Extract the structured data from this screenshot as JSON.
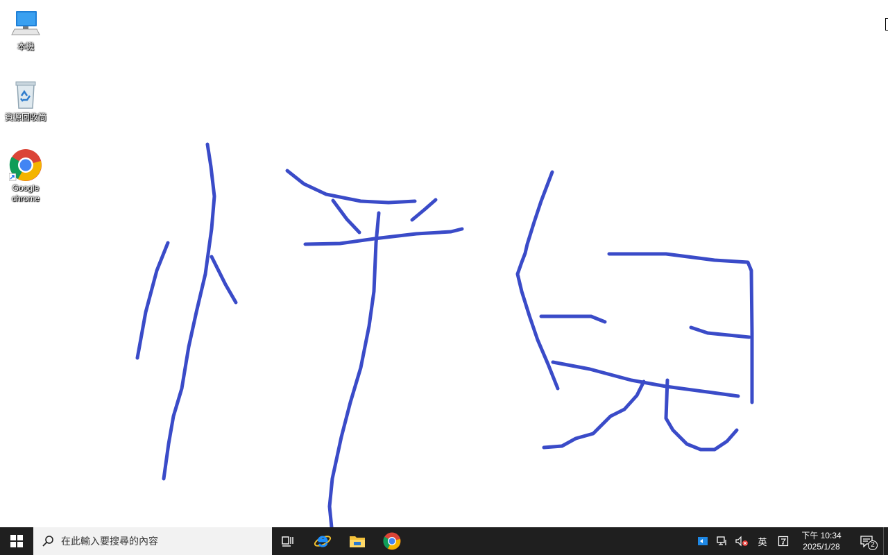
{
  "desktop": {
    "icons": [
      {
        "name": "this-pc",
        "label": "本機",
        "icon": "computer-icon"
      },
      {
        "name": "recycle-bin",
        "label": "資源回收筒",
        "icon": "recycle-bin-icon"
      },
      {
        "name": "google-chrome",
        "label": "Google\nchrome",
        "icon": "chrome-icon"
      }
    ],
    "background_color": "#ffffff",
    "ink_color": "#3a4bc8"
  },
  "taskbar": {
    "search_placeholder": "在此輸入要搜尋的內容",
    "pinned": [
      "task-view-icon",
      "internet-explorer-icon",
      "file-explorer-icon",
      "chrome-icon"
    ],
    "tray": {
      "ime": "英",
      "time": "下午 10:34",
      "date": "2025/1/28",
      "notification_count": "2"
    },
    "background_color": "#1f1f1f"
  }
}
